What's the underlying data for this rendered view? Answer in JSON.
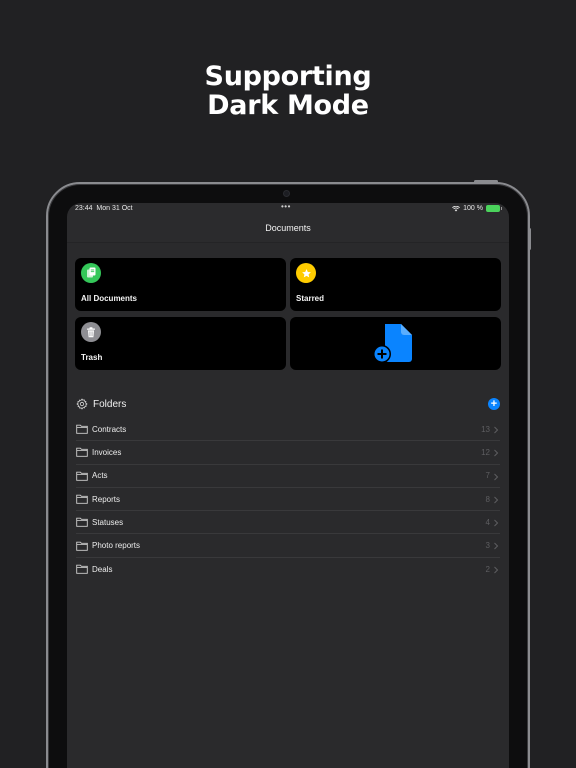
{
  "headline": {
    "line1": "Supporting",
    "line2": "Dark Mode"
  },
  "status_bar": {
    "time": "23:44",
    "date": "Mon 31 Oct",
    "battery": "100 %"
  },
  "nav": {
    "title": "Documents"
  },
  "cards": [
    {
      "label": "All Documents",
      "icon": "documents-icon",
      "color": "#34c759"
    },
    {
      "label": "Starred",
      "icon": "star-icon",
      "color": "#ffcc00"
    },
    {
      "label": "Trash",
      "icon": "trash-icon",
      "color": "#8e8e93"
    },
    {
      "label": "",
      "icon": "add-document-icon",
      "color": "#0a84ff"
    }
  ],
  "folders": {
    "title": "Folders",
    "items": [
      {
        "name": "Contracts",
        "count": "13"
      },
      {
        "name": "Invoices",
        "count": "12"
      },
      {
        "name": "Acts",
        "count": "7"
      },
      {
        "name": "Reports",
        "count": "8"
      },
      {
        "name": "Statuses",
        "count": "4"
      },
      {
        "name": "Photo reports",
        "count": "3"
      },
      {
        "name": "Deals",
        "count": "2"
      }
    ]
  },
  "colors": {
    "background": "#212123",
    "screen": "#2b2b2d",
    "accent": "#0a84ff"
  }
}
